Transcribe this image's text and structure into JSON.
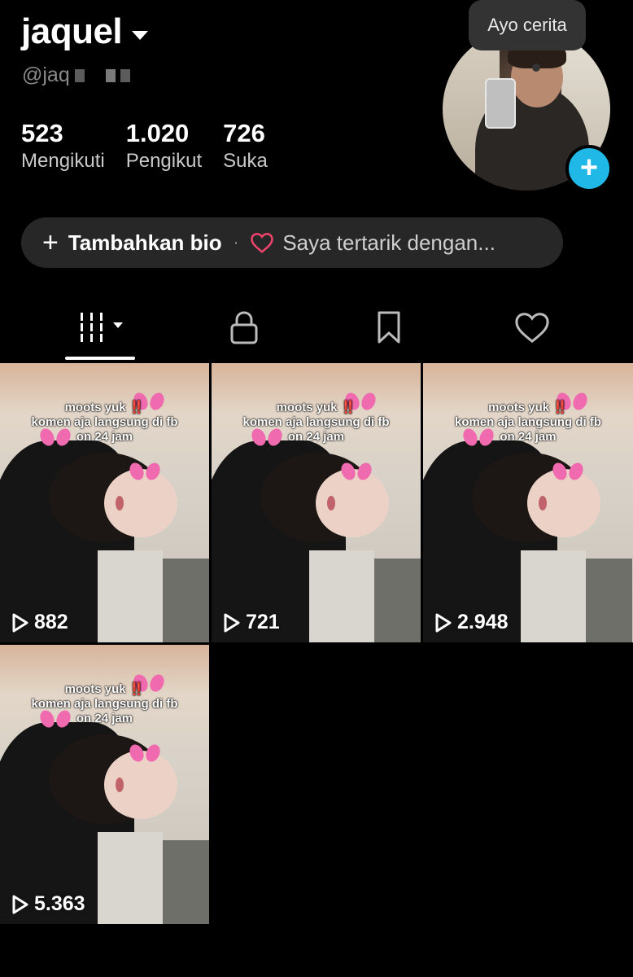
{
  "profile": {
    "username": "jaquel",
    "handle_visible": "@jaq",
    "stats": [
      {
        "value": "523",
        "label": "Mengikuti"
      },
      {
        "value": "1.020",
        "label": "Pengikut"
      },
      {
        "value": "726",
        "label": "Suka"
      }
    ],
    "story_bubble": "Ayo cerita",
    "accent_color": "#20b8e6"
  },
  "bio": {
    "add_label": "Tambahkan bio",
    "separator": "·",
    "interest_label": "Saya tertarik dengan..."
  },
  "tabs": [
    {
      "icon": "grid-icon",
      "active": true
    },
    {
      "icon": "lock-icon"
    },
    {
      "icon": "bookmark-icon"
    },
    {
      "icon": "heart-icon"
    }
  ],
  "videos": [
    {
      "caption_1": "moots yuk ‼️",
      "caption_2": "komen aja langsung di fb",
      "caption_3": "on 24 jam",
      "views": "882"
    },
    {
      "caption_1": "moots yuk ‼️",
      "caption_2": "komen aja langsung di fb",
      "caption_3": "on 24 jam",
      "views": "721"
    },
    {
      "caption_1": "moots yuk ‼️",
      "caption_2": "komen aja langsung di fb",
      "caption_3": "on 24 jam",
      "views": "2.948"
    },
    {
      "caption_1": "moots yuk ‼️",
      "caption_2": "komen aja langsung di fb",
      "caption_3": "on 24 jam",
      "views": "5.363"
    }
  ]
}
